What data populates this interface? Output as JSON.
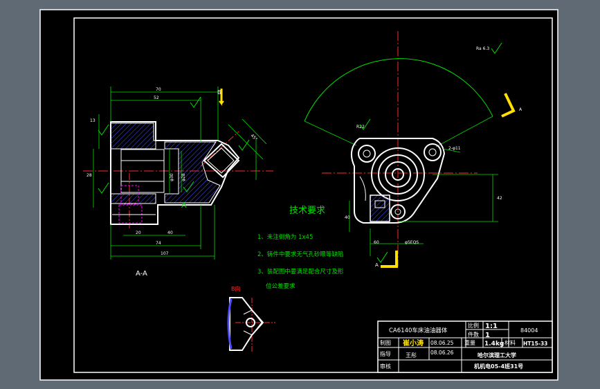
{
  "colors": {
    "bg": "#5f6a74",
    "paper": "#000000",
    "line": "#ffffff",
    "center": "#ff2a2a",
    "dim": "#00e000",
    "hatch": "#4d4dff",
    "arrow": "#ffe000",
    "magenta": "#ff00ff",
    "yellow_text": "#ffffff"
  },
  "section_label": "A-A",
  "view_b_label": "B向",
  "arrow_b_label": "B",
  "section_marker_a": "A",
  "section_marker_a2": "A",
  "arrow_a_label": "A",
  "tech": {
    "title": "技术要求",
    "items": [
      "1、未注倒角为 1x45",
      "2、铸件中要求无气孔砂眼等缺陷",
      "3、装配图中要满足配合尺寸及形",
      "位公差要求"
    ]
  },
  "dims_left": {
    "top1": "70",
    "top2": "52",
    "bottom1": "20",
    "bottom2": "40",
    "bottom3": "74",
    "bottom4": "107",
    "side1": "13",
    "side2": "28",
    "dia1": "φ30",
    "dia2": "φ28",
    "angle": "45°"
  },
  "dims_right": {
    "r1": "R22",
    "d1": "42",
    "w1": "60",
    "h1": "40",
    "small": "2-φ11",
    "note": "φ5EQS"
  },
  "surface_symbol": "Ra 6.3",
  "title_block": {
    "part_name": "CA6140车床油油器体",
    "scale_label": "比例",
    "scale_value": "1:1",
    "drawing_no": "84004",
    "qty_label": "件数",
    "qty_value": "1",
    "drawn_label": "制图",
    "drawn_name": "崔小涛",
    "drawn_date": "08.06.25",
    "weight_label": "重量",
    "weight_value": "1.4kg",
    "material_label": "材料",
    "material_value": "HT15-33",
    "guide_label": "指导",
    "guide_name": "王彤",
    "guide_date": "08.06.26",
    "school": "哈尔滨理工大学",
    "class": "机机电05-4班31号",
    "review_label": "审核"
  }
}
